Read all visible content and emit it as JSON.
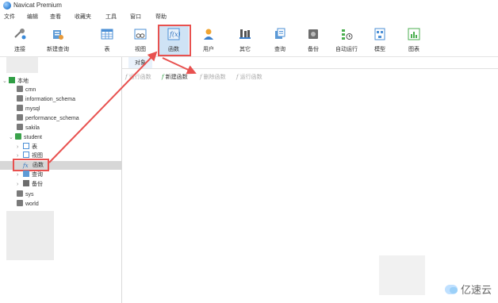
{
  "app": {
    "title": "Navicat Premium",
    "logo_icon": "navicat-logo-icon"
  },
  "menu": [
    "文件",
    "编辑",
    "查看",
    "收藏夹",
    "工具",
    "窗口",
    "帮助"
  ],
  "toolbar": [
    {
      "label": "连接",
      "icon": "connection-icon"
    },
    {
      "label": "新建查询",
      "icon": "new-query-icon"
    },
    {
      "label": "表",
      "icon": "table-icon"
    },
    {
      "label": "视图",
      "icon": "view-icon"
    },
    {
      "label": "函数",
      "icon": "function-icon",
      "active": true
    },
    {
      "label": "用户",
      "icon": "user-icon"
    },
    {
      "label": "其它",
      "icon": "other-icon"
    },
    {
      "label": "查询",
      "icon": "query-icon"
    },
    {
      "label": "备份",
      "icon": "backup-icon"
    },
    {
      "label": "自动运行",
      "icon": "schedule-icon"
    },
    {
      "label": "模型",
      "icon": "model-icon"
    },
    {
      "label": "图表",
      "icon": "chart-icon"
    }
  ],
  "sidebar": {
    "connection": "本地",
    "databases": [
      "cmn",
      "information_schema",
      "mysql",
      "performance_schema",
      "sakila",
      "student"
    ],
    "student_children": [
      "表",
      "视图",
      "函数",
      "查询",
      "备份"
    ],
    "more_databases": [
      "sys",
      "world"
    ]
  },
  "tabs": {
    "object": "对象"
  },
  "object_toolbar": [
    {
      "label": "运行函数",
      "enabled": false
    },
    {
      "label": "新建函数",
      "enabled": true
    },
    {
      "label": "删除函数",
      "enabled": false
    },
    {
      "label": "运行函数",
      "enabled": false
    }
  ],
  "watermark": "亿速云",
  "colors": {
    "highlight": "#e8514f",
    "active_bg": "#cfe3f5",
    "selected_row": "#d7d7d7"
  }
}
